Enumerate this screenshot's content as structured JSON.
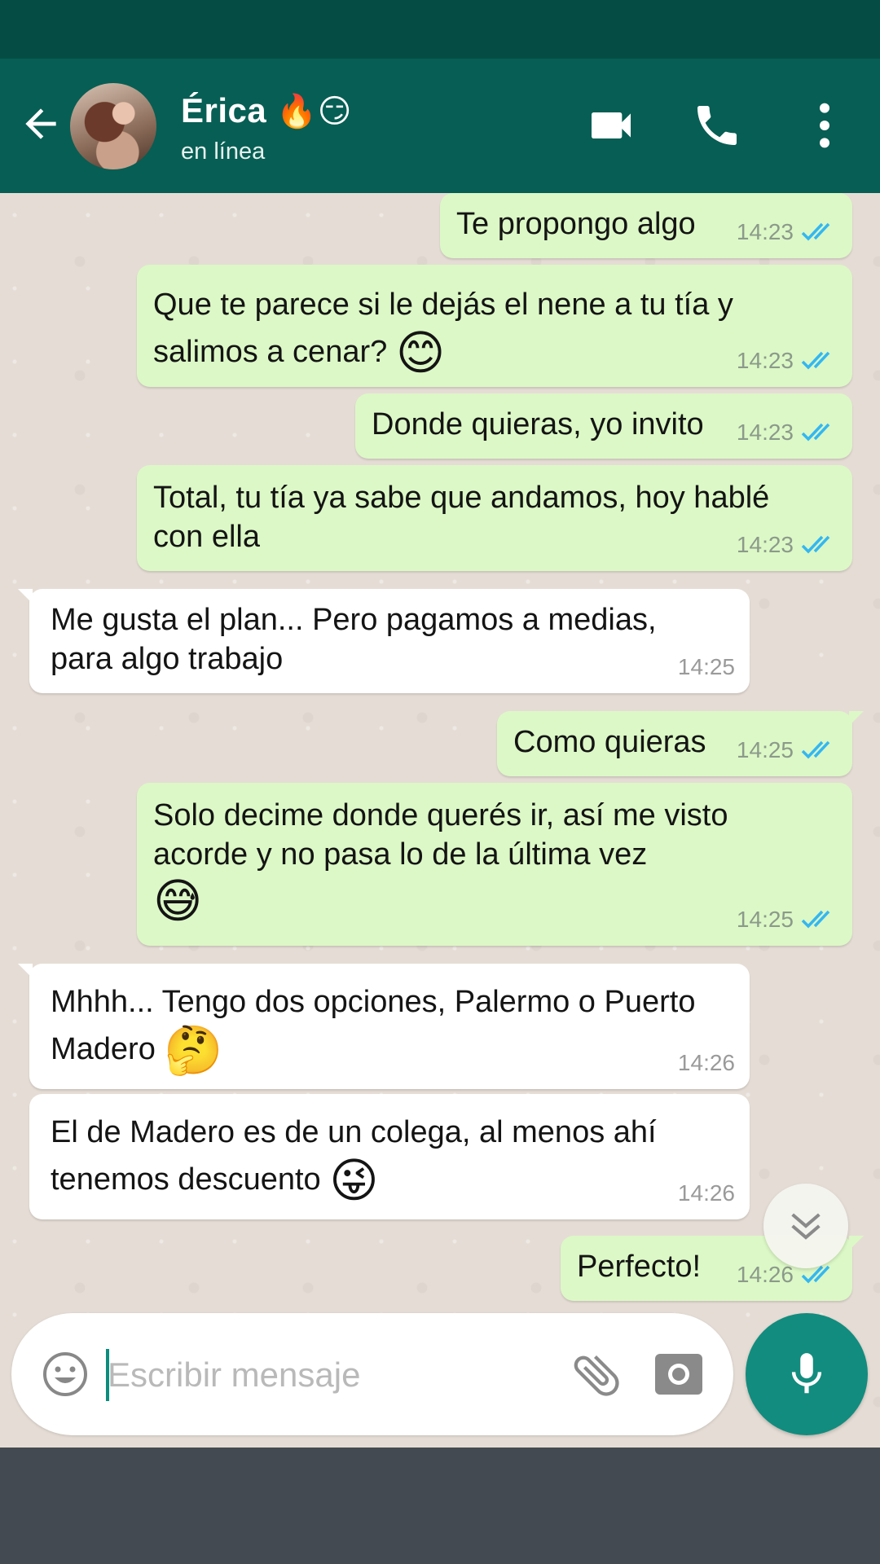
{
  "header": {
    "contact_name": "Érica",
    "contact_emojis": "🔥😏",
    "status": "en línea",
    "icons": [
      "back-arrow-icon",
      "video-call-icon",
      "phone-icon",
      "more-vert-icon"
    ]
  },
  "messages": [
    {
      "dir": "out",
      "text": "Te propongo algo",
      "time": "14:23",
      "read": true
    },
    {
      "dir": "out",
      "text": "Que te parece si le dejás el nene a tu tía y salimos a cenar?",
      "emoji": "😊",
      "time": "14:23",
      "read": true
    },
    {
      "dir": "out",
      "text": "Donde quieras, yo invito",
      "time": "14:23",
      "read": true
    },
    {
      "dir": "out",
      "text": "Total, tu tía ya sabe que andamos, hoy hablé con ella",
      "time": "14:23",
      "read": true
    },
    {
      "dir": "in",
      "text": "Me gusta el plan... Pero pagamos a medias, para algo trabajo",
      "time": "14:25"
    },
    {
      "dir": "out",
      "text": "Como quieras",
      "time": "14:25",
      "read": true
    },
    {
      "dir": "out",
      "text": " Solo decime donde querés ir, así me visto acorde y no pasa lo de la última vez",
      "emoji": "😅",
      "time": "14:25",
      "read": true
    },
    {
      "dir": "in",
      "text": "Mhhh... Tengo dos opciones, Palermo o Puerto Madero",
      "emoji": "🤔",
      "time": "14:26"
    },
    {
      "dir": "in",
      "text": "El de Madero es de un colega, al menos ahí tenemos descuento",
      "emoji": "😜",
      "time": "14:26"
    },
    {
      "dir": "out",
      "text": "Perfecto!",
      "time": "14:26",
      "read": true
    }
  ],
  "input": {
    "placeholder": "Escribir mensaje",
    "value": ""
  },
  "colors": {
    "header": "#075e54",
    "statusbar": "#054d44",
    "outgoing_bubble": "#dcf8c6",
    "incoming_bubble": "#ffffff",
    "read_ticks": "#34b7f1",
    "mic_button": "#128c7e",
    "chat_background": "#e5ddd5"
  }
}
